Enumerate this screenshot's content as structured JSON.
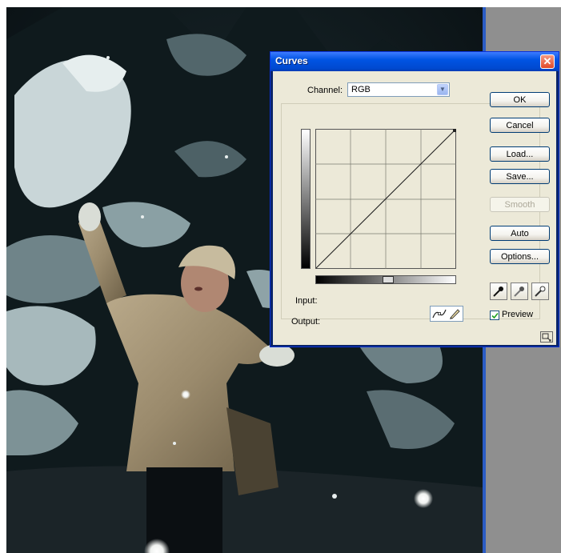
{
  "dialog": {
    "title": "Curves",
    "close_symbol": "✕",
    "channel": {
      "label": "Channel:",
      "value": "RGB",
      "arrow": "▼"
    },
    "buttons": {
      "ok": "OK",
      "cancel": "Cancel",
      "load": "Load...",
      "save": "Save...",
      "smooth": "Smooth",
      "auto": "Auto",
      "options": "Options..."
    },
    "labels": {
      "input": "Input:",
      "output": "Output:"
    },
    "preview": {
      "label": "Preview",
      "checked": true
    },
    "icons": {
      "curve_point_tool": "curve-point-icon",
      "pencil_tool": "pencil-icon",
      "black_eyedropper": "eyedropper-black-icon",
      "gray_eyedropper": "eyedropper-gray-icon",
      "white_eyedropper": "eyedropper-white-icon",
      "resize": "expand-view-icon"
    }
  },
  "colors": {
    "title_bar": "#0054e3",
    "dialog_face": "#ece9d8",
    "close_button": "#e04a2a",
    "workspace_grey": "#8f8f8f"
  }
}
